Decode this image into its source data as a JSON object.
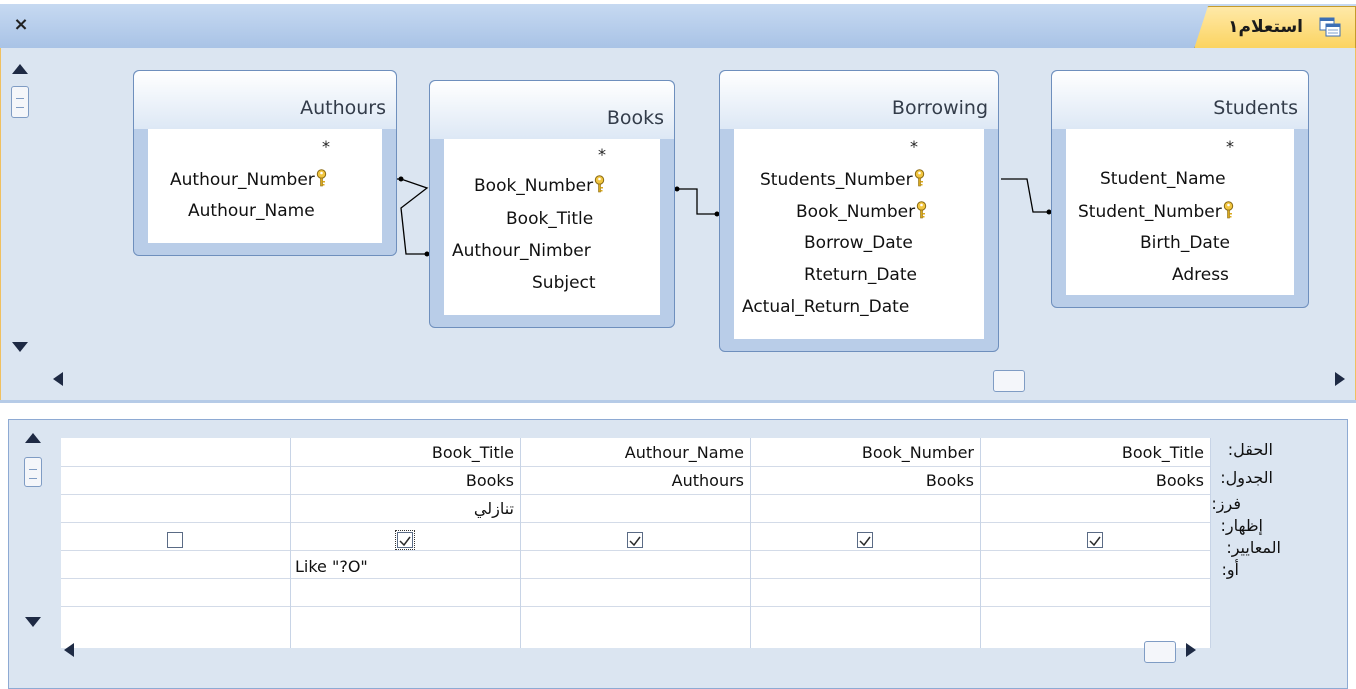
{
  "window": {
    "title": "استعلام١",
    "close_glyph": "×"
  },
  "design": {
    "tables": [
      {
        "name": "Authours",
        "star": "*",
        "fields": [
          {
            "label": "Authour_Number",
            "key": true
          },
          {
            "label": "Authour_Name",
            "key": false
          }
        ]
      },
      {
        "name": "Books",
        "star": "*",
        "fields": [
          {
            "label": "Book_Number",
            "key": true
          },
          {
            "label": "Book_Title",
            "key": false
          },
          {
            "label": "Authour_Nimber",
            "key": false
          },
          {
            "label": "Subject",
            "key": false
          }
        ]
      },
      {
        "name": "Borrowing",
        "star": "*",
        "fields": [
          {
            "label": "Students_Number",
            "key": true
          },
          {
            "label": "Book_Number",
            "key": true
          },
          {
            "label": "Borrow_Date",
            "key": false
          },
          {
            "label": "Rteturn_Date",
            "key": false
          },
          {
            "label": "Actual_Return_Date",
            "key": false
          }
        ]
      },
      {
        "name": "Students",
        "star": "*",
        "fields": [
          {
            "label": "Student_Name",
            "key": false
          },
          {
            "label": "Student_Number",
            "key": true
          },
          {
            "label": "Birth_Date",
            "key": false
          },
          {
            "label": "Adress",
            "key": false
          }
        ]
      }
    ]
  },
  "grid": {
    "row_labels": {
      "field": "الحقل:",
      "table": "الجدول:",
      "sort": "فرز:",
      "show": "إظهار:",
      "criteria": "المعايير:",
      "or": "أو:"
    },
    "columns": [
      {
        "field": "Book_Title",
        "table": "Books",
        "sort": "",
        "show": true,
        "criteria": ""
      },
      {
        "field": "Book_Number",
        "table": "Books",
        "sort": "",
        "show": true,
        "criteria": ""
      },
      {
        "field": "Authour_Name",
        "table": "Authours",
        "sort": "",
        "show": true,
        "criteria": ""
      },
      {
        "field": "Book_Title",
        "table": "Books",
        "sort": "تنازلي",
        "show": true,
        "criteria": "Like \"?O\""
      },
      {
        "field": "",
        "table": "",
        "sort": "",
        "show": false,
        "criteria": ""
      }
    ]
  },
  "colors": {
    "accent_tab": "#fbd35f",
    "pane_bg": "#dbe5f1",
    "table_frame": "#b9cde8"
  }
}
